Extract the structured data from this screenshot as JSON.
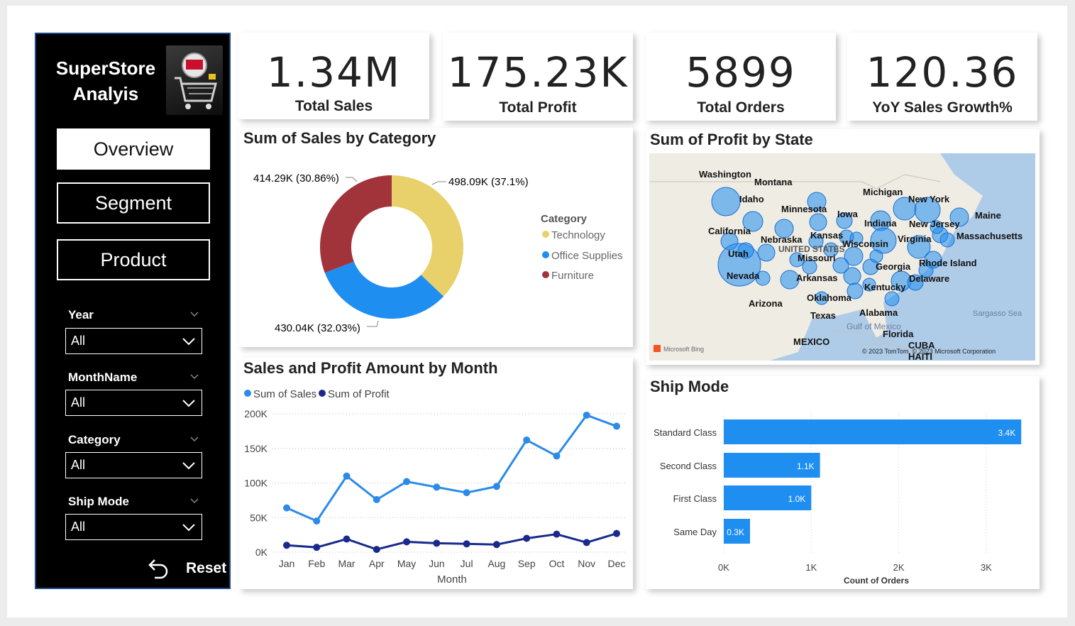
{
  "sidebar": {
    "title": "SuperStore Analyis",
    "logo_icon": "shopping-cart-black-friday",
    "nav": [
      {
        "label": "Overview",
        "active": true
      },
      {
        "label": "Segment",
        "active": false
      },
      {
        "label": "Product",
        "active": false
      }
    ],
    "filters": [
      {
        "label": "Year",
        "value": "All"
      },
      {
        "label": "MonthName",
        "value": "All"
      },
      {
        "label": "Category",
        "value": "All"
      },
      {
        "label": "Ship Mode",
        "value": "All"
      }
    ],
    "reset_label": "Reset"
  },
  "kpis": [
    {
      "value": "1.34M",
      "label": "Total Sales"
    },
    {
      "value": "175.23K",
      "label": "Total Profit"
    },
    {
      "value": "5899",
      "label": "Total Orders"
    },
    {
      "value": "120.36",
      "label": "YoY Sales Growth%"
    }
  ],
  "donut": {
    "title": "Sum of Sales by Category",
    "legend_title": "Category",
    "slices": [
      {
        "name": "Technology",
        "value": 498.09,
        "label": "498.09K (37.1%)",
        "color": "#e8d06a"
      },
      {
        "name": "Office Supplies",
        "value": 430.04,
        "label": "430.04K (32.03%)",
        "color": "#1f8ef1"
      },
      {
        "name": "Furniture",
        "value": 414.29,
        "label": "414.29K (30.86%)",
        "color": "#a1333b"
      }
    ]
  },
  "map": {
    "title": "Sum of Profit by State",
    "labels": [
      "Washington",
      "Montana",
      "Idaho",
      "Minnesota",
      "Michigan",
      "New York",
      "Iowa",
      "Maine",
      "Indiana",
      "New Jersey",
      "California",
      "Kansas",
      "Massachusetts",
      "Nebraska",
      "Virginia",
      "Wisconsin",
      "UNITED STATES",
      "Utah",
      "Missouri",
      "Georgia",
      "Rhode Island",
      "Nevada",
      "Arkansas",
      "Delaware",
      "Kentucky",
      "Arizona",
      "Oklahoma",
      "Alabama",
      "Texas",
      "Gulf of Mexico",
      "Florida",
      "Sargasso Sea",
      "MEXICO",
      "CUBA",
      "HAITI"
    ],
    "bing_label": "Microsoft Bing",
    "copyright": "© 2023 TomTom, © 2023 Microsoft Corporation"
  },
  "line": {
    "title": "Sales and Profit Amount by Month",
    "xlabel": "Month",
    "y_ticks": [
      "0K",
      "50K",
      "100K",
      "150K",
      "200K"
    ],
    "series_colors": {
      "sales": "#2b8be6",
      "profit": "#1a2a8c"
    }
  },
  "ship": {
    "title": "Ship Mode",
    "xlabel": "Count of Orders",
    "x_ticks": [
      "0K",
      "1K",
      "2K",
      "3K"
    ],
    "bar_color": "#1f8ef1"
  },
  "chart_data": [
    {
      "type": "line",
      "title": "Sales and Profit Amount by Month",
      "xlabel": "Month",
      "ylabel": "",
      "x": [
        "Jan",
        "Feb",
        "Mar",
        "Apr",
        "May",
        "Jun",
        "Jul",
        "Aug",
        "Sep",
        "Oct",
        "Nov",
        "Dec"
      ],
      "ylim": [
        0,
        200000
      ],
      "series": [
        {
          "name": "Sum of Sales",
          "values": [
            64000,
            45000,
            110000,
            76000,
            102000,
            94000,
            86000,
            95000,
            162000,
            139000,
            198000,
            182000
          ]
        },
        {
          "name": "Sum of Profit",
          "values": [
            10000,
            7000,
            19000,
            4000,
            15000,
            13000,
            12000,
            11000,
            20000,
            26000,
            14000,
            27000
          ]
        }
      ]
    },
    {
      "type": "bar",
      "title": "Ship Mode",
      "xlabel": "Count of Orders",
      "categories": [
        "Standard Class",
        "Second Class",
        "First Class",
        "Same Day"
      ],
      "values": [
        3400,
        1100,
        1000,
        300
      ],
      "data_labels": [
        "3.4K",
        "1.1K",
        "1.0K",
        "0.3K"
      ],
      "xlim": [
        0,
        3500
      ]
    },
    {
      "type": "pie",
      "title": "Sum of Sales by Category",
      "categories": [
        "Technology",
        "Office Supplies",
        "Furniture"
      ],
      "values": [
        498090,
        430040,
        414290
      ]
    }
  ]
}
